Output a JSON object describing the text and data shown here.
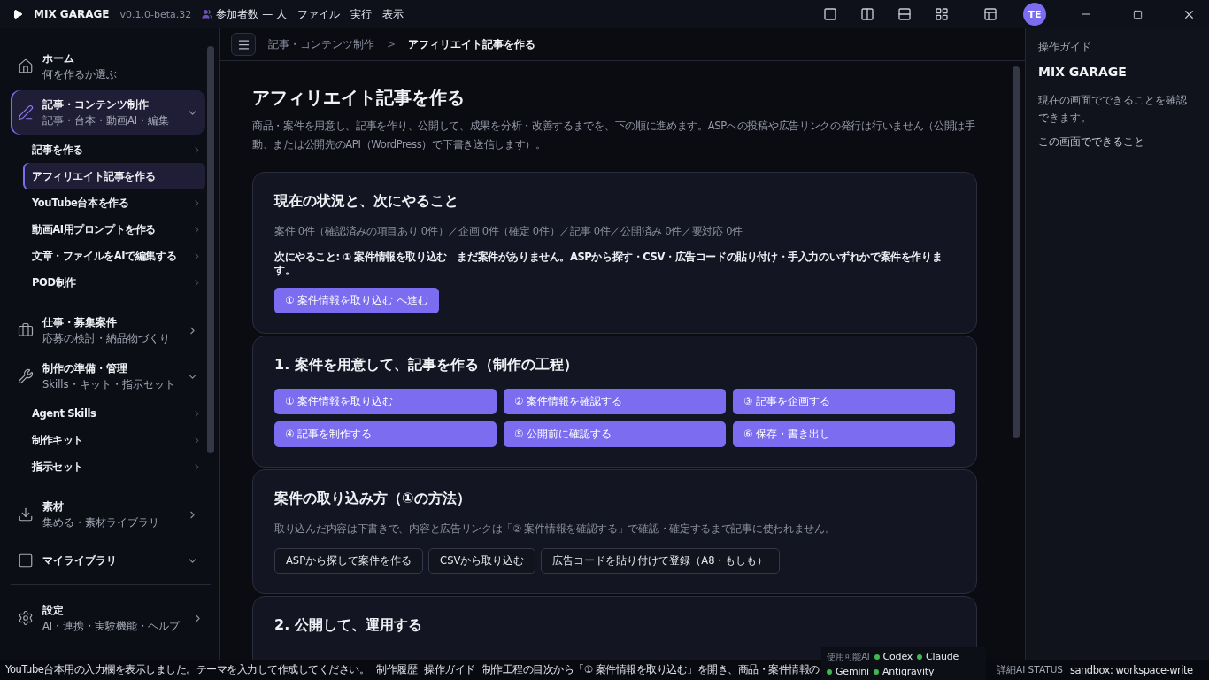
{
  "titlebar": {
    "app_name": "MIX GARAGE",
    "version": "v0.1.0-beta.32",
    "participants": "参加者数 — 人",
    "menus": [
      "ファイル",
      "実行",
      "表示"
    ],
    "avatar": "TE"
  },
  "sidebar": {
    "groups": [
      {
        "kind": "link",
        "title": "ホーム",
        "subtitle": "何を作るか選ぶ",
        "selected": false
      },
      {
        "kind": "group",
        "title": "記事・コンテンツ制作",
        "subtitle": "記事・台本・動画AI・編集",
        "selected": true,
        "expanded": true,
        "children": [
          {
            "label": "記事を作る",
            "selected": false
          },
          {
            "label": "アフィリエイト記事を作る",
            "selected": true
          },
          {
            "label": "YouTube台本を作る",
            "selected": false
          },
          {
            "label": "動画AI用プロンプトを作る",
            "selected": false
          },
          {
            "label": "文章・ファイルをAIで編集する",
            "selected": false
          },
          {
            "label": "POD制作",
            "selected": false
          }
        ]
      },
      {
        "kind": "group",
        "title": "仕事・募集案件",
        "subtitle": "応募の検討・納品物づくり",
        "selected": false,
        "expanded": false
      },
      {
        "kind": "group",
        "title": "制作の準備・管理",
        "subtitle": "Skills・キット・指示セット",
        "selected": false,
        "expanded": true,
        "children": [
          {
            "label": "Agent Skills",
            "selected": false
          },
          {
            "label": "制作キット",
            "selected": false
          },
          {
            "label": "指示セット",
            "selected": false
          }
        ]
      },
      {
        "kind": "group",
        "title": "素材",
        "subtitle": "集める・素材ライブラリ",
        "selected": false,
        "expanded": false
      },
      {
        "kind": "group",
        "title": "マイライブラリ",
        "selected": false,
        "expanded": true
      }
    ],
    "settings": {
      "title": "設定",
      "subtitle": "AI・連携・実験機能・ヘルプ"
    }
  },
  "breadcrumb": {
    "items": [
      "記事・コンテンツ制作",
      "アフィリエイト記事を作る"
    ],
    "separator": ">"
  },
  "page": {
    "title": "アフィリエイト記事を作る",
    "description": "商品・案件を用意し、記事を作り、公開して、成果を分析・改善するまでを、下の順に進めます。ASPへの投稿や広告リンクの発行は行いません（公開は手動、または公開先のAPI（WordPress）で下書き送信します）。",
    "cards": [
      {
        "kind": "status",
        "title": "現在の状況と、次にやること",
        "summary": "案件 0件（確認済みの項目あり 0件）／企画 0件（確定 0件）／記事 0件／公開済み 0件／要対応 0件",
        "next": "次にやること: ① 案件情報を取り込む　まだ案件がありません。ASPから探す・CSV・広告コードの貼り付け・手入力のいずれかで案件を作ります。",
        "buttons": [
          "① 案件情報を取り込む へ進む"
        ]
      },
      {
        "kind": "steps",
        "title": "1. 案件を用意して、記事を作る（制作の工程）",
        "buttons": [
          "① 案件情報を取り込む",
          "② 案件情報を確認する",
          "③ 記事を企画する",
          "④ 記事を制作する",
          "⑤ 公開前に確認する",
          "⑥ 保存・書き出し"
        ]
      },
      {
        "kind": "methods",
        "title": "案件の取り込み方（①の方法）",
        "summary": "取り込んだ内容は下書きで、内容と広告リンクは「② 案件情報を確認する」で確認・確定するまで記事に使われません。",
        "buttons": [
          "ASPから探して案件を作る",
          "CSVから取り込む",
          "広告コードを貼り付けて登録（A8・もしも）"
        ]
      },
      {
        "kind": "steps",
        "title": "2. 公開して、運用する"
      }
    ]
  },
  "guide": {
    "label": "操作ガイド",
    "title": "MIX GARAGE",
    "text": "現在の画面でできることを確認できます。",
    "section": "この画面でできること"
  },
  "status_bar": {
    "message": "YouTube台本用の入力欄を表示しました。テーマを入力して作成してください。",
    "links": [
      "制作履歴",
      "操作ガイド"
    ],
    "hint": "制作工程の目次から「① 案件情報を取り込む」を開き、商品・案件情報の",
    "ai_label": "使用可能AI",
    "ais": [
      {
        "name": "Codex",
        "color": "#3fb950"
      },
      {
        "name": "Claude",
        "color": "#3fb950"
      },
      {
        "name": "Gemini",
        "color": "#3fb950"
      },
      {
        "name": "Antigravity",
        "color": "#3fb950"
      }
    ],
    "detail": "詳細AI STATUS",
    "sandbox": "sandbox: workspace-write"
  }
}
